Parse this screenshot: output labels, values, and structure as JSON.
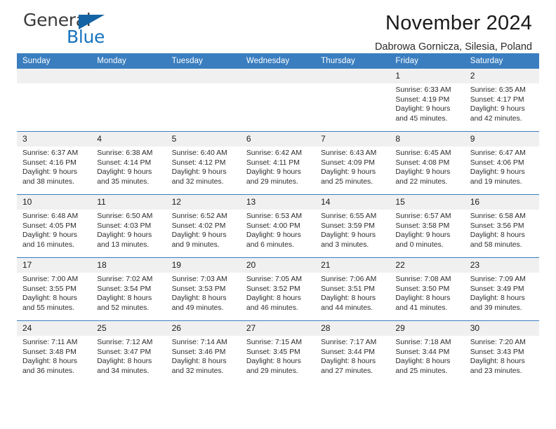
{
  "brand": {
    "name_part1": "General",
    "name_part2": "Blue",
    "flag_icon": "triangle-flag-icon"
  },
  "header": {
    "month_title": "November 2024",
    "location": "Dabrowa Gornicza, Silesia, Poland"
  },
  "theme": {
    "header_blue": "#3a7ebf",
    "brand_blue": "#1773bf",
    "daynum_bg": "#f0f0f0",
    "text": "#231f20"
  },
  "calendar": {
    "weekday_headers": [
      "Sunday",
      "Monday",
      "Tuesday",
      "Wednesday",
      "Thursday",
      "Friday",
      "Saturday"
    ],
    "labels": {
      "sunrise": "Sunrise:",
      "sunset": "Sunset:",
      "daylight": "Daylight:"
    },
    "weeks": [
      [
        {
          "day": "",
          "empty": true
        },
        {
          "day": "",
          "empty": true
        },
        {
          "day": "",
          "empty": true
        },
        {
          "day": "",
          "empty": true
        },
        {
          "day": "",
          "empty": true
        },
        {
          "day": "1",
          "sunrise": "Sunrise: 6:33 AM",
          "sunset": "Sunset: 4:19 PM",
          "daylight": "Daylight: 9 hours and 45 minutes."
        },
        {
          "day": "2",
          "sunrise": "Sunrise: 6:35 AM",
          "sunset": "Sunset: 4:17 PM",
          "daylight": "Daylight: 9 hours and 42 minutes."
        }
      ],
      [
        {
          "day": "3",
          "sunrise": "Sunrise: 6:37 AM",
          "sunset": "Sunset: 4:16 PM",
          "daylight": "Daylight: 9 hours and 38 minutes."
        },
        {
          "day": "4",
          "sunrise": "Sunrise: 6:38 AM",
          "sunset": "Sunset: 4:14 PM",
          "daylight": "Daylight: 9 hours and 35 minutes."
        },
        {
          "day": "5",
          "sunrise": "Sunrise: 6:40 AM",
          "sunset": "Sunset: 4:12 PM",
          "daylight": "Daylight: 9 hours and 32 minutes."
        },
        {
          "day": "6",
          "sunrise": "Sunrise: 6:42 AM",
          "sunset": "Sunset: 4:11 PM",
          "daylight": "Daylight: 9 hours and 29 minutes."
        },
        {
          "day": "7",
          "sunrise": "Sunrise: 6:43 AM",
          "sunset": "Sunset: 4:09 PM",
          "daylight": "Daylight: 9 hours and 25 minutes."
        },
        {
          "day": "8",
          "sunrise": "Sunrise: 6:45 AM",
          "sunset": "Sunset: 4:08 PM",
          "daylight": "Daylight: 9 hours and 22 minutes."
        },
        {
          "day": "9",
          "sunrise": "Sunrise: 6:47 AM",
          "sunset": "Sunset: 4:06 PM",
          "daylight": "Daylight: 9 hours and 19 minutes."
        }
      ],
      [
        {
          "day": "10",
          "sunrise": "Sunrise: 6:48 AM",
          "sunset": "Sunset: 4:05 PM",
          "daylight": "Daylight: 9 hours and 16 minutes."
        },
        {
          "day": "11",
          "sunrise": "Sunrise: 6:50 AM",
          "sunset": "Sunset: 4:03 PM",
          "daylight": "Daylight: 9 hours and 13 minutes."
        },
        {
          "day": "12",
          "sunrise": "Sunrise: 6:52 AM",
          "sunset": "Sunset: 4:02 PM",
          "daylight": "Daylight: 9 hours and 9 minutes."
        },
        {
          "day": "13",
          "sunrise": "Sunrise: 6:53 AM",
          "sunset": "Sunset: 4:00 PM",
          "daylight": "Daylight: 9 hours and 6 minutes."
        },
        {
          "day": "14",
          "sunrise": "Sunrise: 6:55 AM",
          "sunset": "Sunset: 3:59 PM",
          "daylight": "Daylight: 9 hours and 3 minutes."
        },
        {
          "day": "15",
          "sunrise": "Sunrise: 6:57 AM",
          "sunset": "Sunset: 3:58 PM",
          "daylight": "Daylight: 9 hours and 0 minutes."
        },
        {
          "day": "16",
          "sunrise": "Sunrise: 6:58 AM",
          "sunset": "Sunset: 3:56 PM",
          "daylight": "Daylight: 8 hours and 58 minutes."
        }
      ],
      [
        {
          "day": "17",
          "sunrise": "Sunrise: 7:00 AM",
          "sunset": "Sunset: 3:55 PM",
          "daylight": "Daylight: 8 hours and 55 minutes."
        },
        {
          "day": "18",
          "sunrise": "Sunrise: 7:02 AM",
          "sunset": "Sunset: 3:54 PM",
          "daylight": "Daylight: 8 hours and 52 minutes."
        },
        {
          "day": "19",
          "sunrise": "Sunrise: 7:03 AM",
          "sunset": "Sunset: 3:53 PM",
          "daylight": "Daylight: 8 hours and 49 minutes."
        },
        {
          "day": "20",
          "sunrise": "Sunrise: 7:05 AM",
          "sunset": "Sunset: 3:52 PM",
          "daylight": "Daylight: 8 hours and 46 minutes."
        },
        {
          "day": "21",
          "sunrise": "Sunrise: 7:06 AM",
          "sunset": "Sunset: 3:51 PM",
          "daylight": "Daylight: 8 hours and 44 minutes."
        },
        {
          "day": "22",
          "sunrise": "Sunrise: 7:08 AM",
          "sunset": "Sunset: 3:50 PM",
          "daylight": "Daylight: 8 hours and 41 minutes."
        },
        {
          "day": "23",
          "sunrise": "Sunrise: 7:09 AM",
          "sunset": "Sunset: 3:49 PM",
          "daylight": "Daylight: 8 hours and 39 minutes."
        }
      ],
      [
        {
          "day": "24",
          "sunrise": "Sunrise: 7:11 AM",
          "sunset": "Sunset: 3:48 PM",
          "daylight": "Daylight: 8 hours and 36 minutes."
        },
        {
          "day": "25",
          "sunrise": "Sunrise: 7:12 AM",
          "sunset": "Sunset: 3:47 PM",
          "daylight": "Daylight: 8 hours and 34 minutes."
        },
        {
          "day": "26",
          "sunrise": "Sunrise: 7:14 AM",
          "sunset": "Sunset: 3:46 PM",
          "daylight": "Daylight: 8 hours and 32 minutes."
        },
        {
          "day": "27",
          "sunrise": "Sunrise: 7:15 AM",
          "sunset": "Sunset: 3:45 PM",
          "daylight": "Daylight: 8 hours and 29 minutes."
        },
        {
          "day": "28",
          "sunrise": "Sunrise: 7:17 AM",
          "sunset": "Sunset: 3:44 PM",
          "daylight": "Daylight: 8 hours and 27 minutes."
        },
        {
          "day": "29",
          "sunrise": "Sunrise: 7:18 AM",
          "sunset": "Sunset: 3:44 PM",
          "daylight": "Daylight: 8 hours and 25 minutes."
        },
        {
          "day": "30",
          "sunrise": "Sunrise: 7:20 AM",
          "sunset": "Sunset: 3:43 PM",
          "daylight": "Daylight: 8 hours and 23 minutes."
        }
      ]
    ]
  }
}
